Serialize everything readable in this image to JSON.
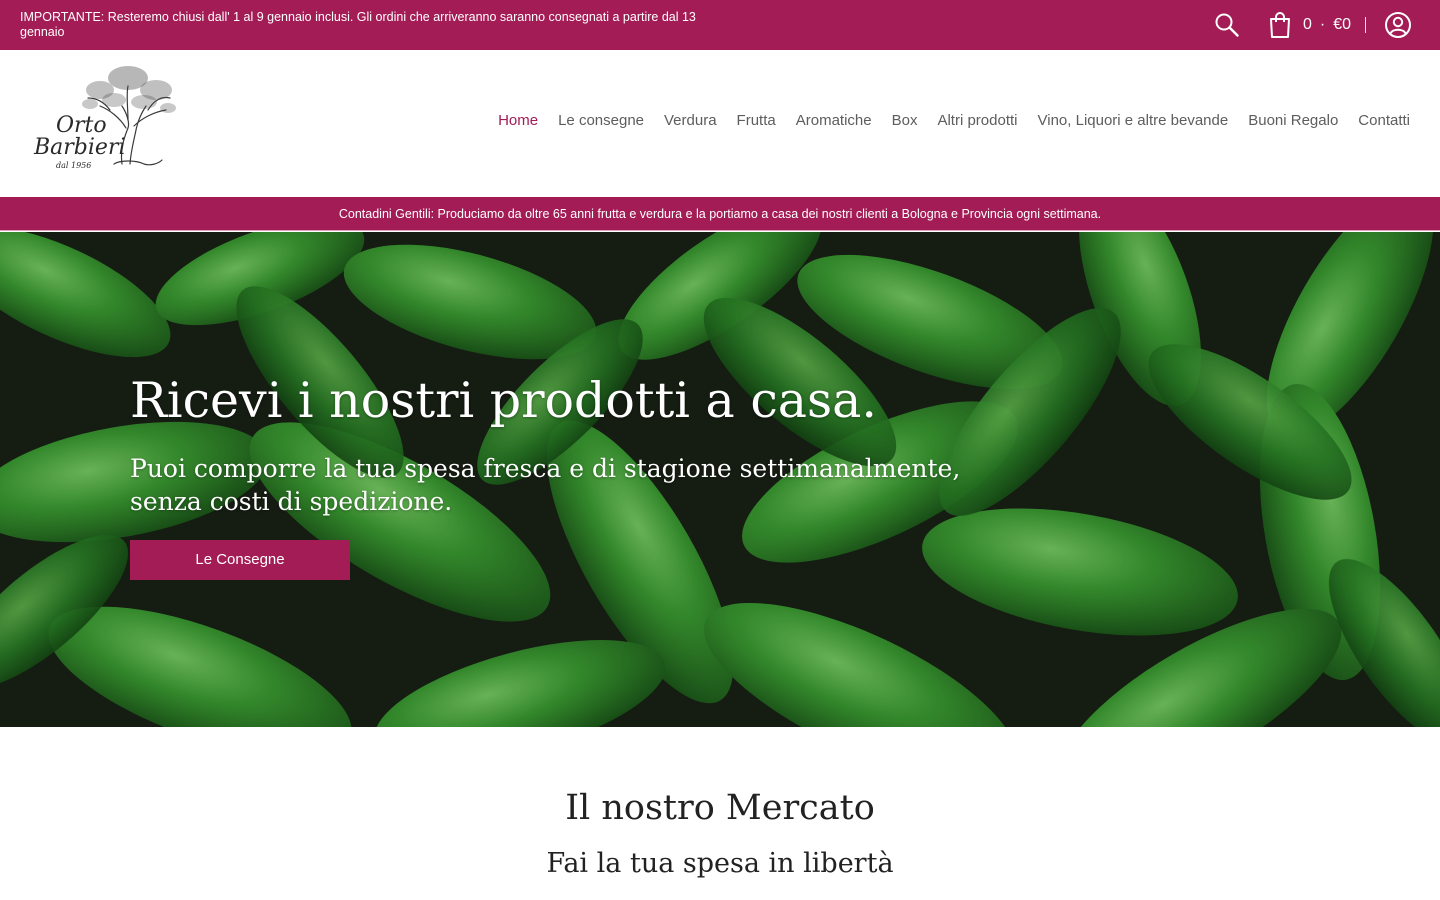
{
  "announcement": {
    "text": "IMPORTANTE: Resteremo chiusi dall' 1 al 9 gennaio inclusi. Gli ordini che arriveranno saranno consegnati a partire dal 13 gennaio"
  },
  "cart": {
    "count": "0",
    "separator": "·",
    "total": "€0"
  },
  "icons": {
    "search": "search-icon",
    "cart": "shopping-bag-icon",
    "account": "user-circle-icon"
  },
  "logo": {
    "line1": "Orto",
    "line2": "Barbieri",
    "since": "dal 1956"
  },
  "nav": {
    "items": [
      {
        "label": "Home",
        "active": true
      },
      {
        "label": "Le consegne"
      },
      {
        "label": "Verdura"
      },
      {
        "label": "Frutta"
      },
      {
        "label": "Aromatiche"
      },
      {
        "label": "Box"
      },
      {
        "label": "Altri prodotti"
      },
      {
        "label": "Vino, Liquori e altre bevande"
      },
      {
        "label": "Buoni Regalo"
      },
      {
        "label": "Contatti"
      }
    ]
  },
  "tagline": "Contadini Gentili: Produciamo da oltre 65 anni frutta e verdura e la portiamo a casa dei nostri clienti a Bologna e Provincia ogni settimana.",
  "hero": {
    "title": "Ricevi i nostri prodotti a casa.",
    "subtitle": "Puoi comporre la tua spesa fresca e di stagione settimanalmente, senza costi di spedizione.",
    "button": "Le Consegne"
  },
  "market": {
    "title": "Il nostro Mercato",
    "subtitle": "Fai la tua spesa in libertà"
  },
  "colors": {
    "brand": "#a31c55",
    "nav_text": "#5d5d5d",
    "heading": "#222222"
  }
}
